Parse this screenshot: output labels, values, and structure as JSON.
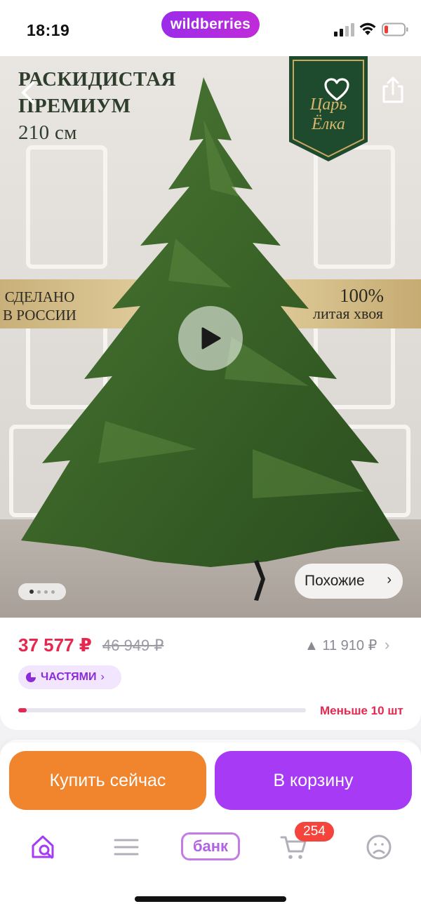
{
  "status_bar": {
    "time": "18:19",
    "brand": "wildberries"
  },
  "hero": {
    "title_line1": "РАСКИДИСТАЯ",
    "title_line2": "ПРЕМИУМ",
    "title_line3": "210 см",
    "logo_text": "Царь Ёлка",
    "banner_left_line1": "СДЕЛАНО",
    "banner_left_line2": "В РОССИИ",
    "banner_right_big": "100%",
    "banner_right_small": "литая хвоя",
    "similar_label": "Похожие",
    "gallery_count": 4,
    "gallery_active": 1
  },
  "price_card": {
    "price": "37 577 ₽",
    "old_price": "46 949 ₽",
    "price_delta": "▲ 11 910 ₽",
    "installments_label": "ЧАСТЯМИ",
    "stock_label": "Меньше 10 шт",
    "stock_fraction": 0.03
  },
  "actions": {
    "buy_now": "Купить сейчас",
    "add_to_cart": "В корзину"
  },
  "tabbar": {
    "bank_label": "банк",
    "cart_count": "254"
  },
  "colors": {
    "accent_purple": "#a73bf5",
    "accent_orange": "#f0852d",
    "price_red": "#e6274f"
  }
}
